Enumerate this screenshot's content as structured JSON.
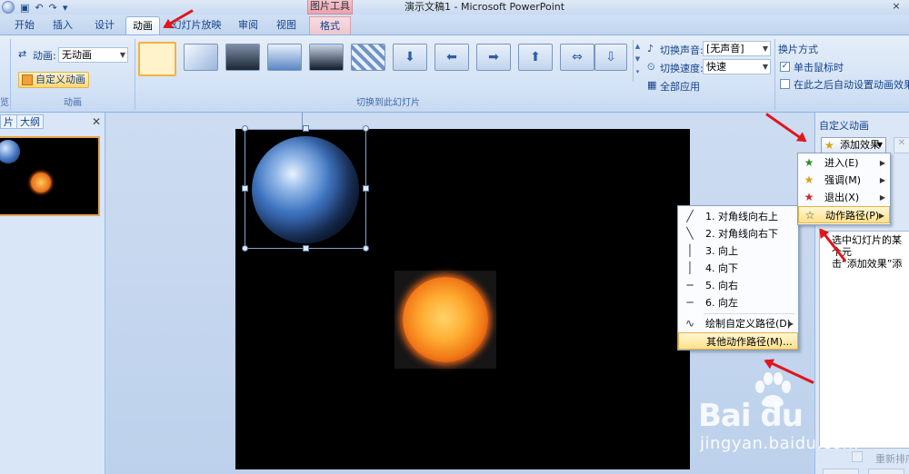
{
  "titlebar": {
    "window_title": "演示文稿1 - Microsoft PowerPoint",
    "context_group": "图片工具",
    "close_glyph": "×"
  },
  "tabs": [
    {
      "label": "开始"
    },
    {
      "label": "插入"
    },
    {
      "label": "设计"
    },
    {
      "label": "动画"
    },
    {
      "label": "幻灯片放映"
    },
    {
      "label": "审阅"
    },
    {
      "label": "视图"
    },
    {
      "label": "格式"
    }
  ],
  "ribbon": {
    "animation_group": {
      "label": "动画",
      "animate_label": "动画:",
      "animate_value": "无动画",
      "custom_button": "自定义动画"
    },
    "transition_group": {
      "label": "切换到此幻灯片",
      "sound_label": "切换声音:",
      "sound_value": "[无声音]",
      "speed_label": "切换速度:",
      "speed_value": "快速",
      "apply_all": "全部应用"
    },
    "advance_group": {
      "title": "换片方式",
      "on_click": "单击鼠标时",
      "on_click_checked": true,
      "auto_after": "在此之后自动设置动画效果:",
      "auto_after_checked": false
    },
    "partial_left_group_label": "览"
  },
  "left_pane": {
    "tab_slides": "片",
    "tab_outline": "大纲",
    "close_glyph": "✕"
  },
  "motion_submenu": {
    "items": [
      {
        "label": "1. 对角线向右上",
        "glyph": "╱"
      },
      {
        "label": "2. 对角线向右下",
        "glyph": "╲"
      },
      {
        "label": "3. 向上",
        "glyph": "│"
      },
      {
        "label": "4. 向下",
        "glyph": "│"
      },
      {
        "label": "5. 向右",
        "glyph": "─"
      },
      {
        "label": "6. 向左",
        "glyph": "─"
      },
      {
        "label": "绘制自定义路径(D)",
        "glyph": "∿"
      },
      {
        "label": "其他动作路径(M)...",
        "glyph": ""
      }
    ]
  },
  "task_pane": {
    "title": "自定义动画",
    "add_effect": "添加效果",
    "hint_line1": "选中幻灯片的某个元",
    "hint_line2": "击“添加效果”添",
    "reorder": "重新排序",
    "add_effect_menu": [
      {
        "label": "进入(E)",
        "glyph": "★",
        "color": "#2e8b2e"
      },
      {
        "label": "强调(M)",
        "glyph": "★",
        "color": "#d6a313"
      },
      {
        "label": "退出(X)",
        "glyph": "★",
        "color": "#d02626"
      },
      {
        "label": "动作路径(P)",
        "glyph": "☆",
        "color": "#444444"
      }
    ]
  },
  "watermark": {
    "brand": "Bai  du",
    "site": "jingyan.baidu.com"
  },
  "colors": {
    "accent": "#15428b",
    "highlight": "#ffe18a",
    "annotation_arrow": "#e0161b"
  }
}
